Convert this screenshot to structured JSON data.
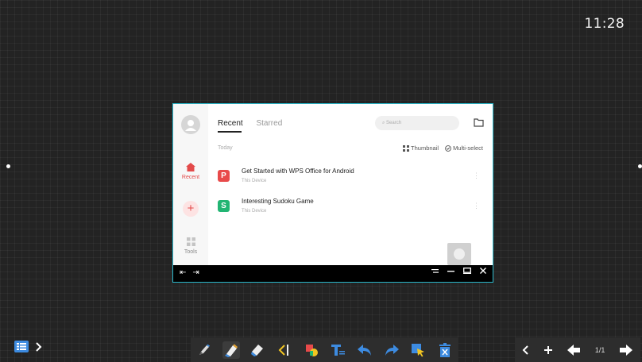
{
  "clock": "11:28",
  "window": {
    "tabs": [
      {
        "label": "Recent",
        "active": true
      },
      {
        "label": "Starred",
        "active": false
      }
    ],
    "search_placeholder": "Search",
    "sidebar": {
      "recent_label": "Recent",
      "tools_label": "Tools"
    },
    "section_title": "Today",
    "view_options": {
      "thumbnail": "Thumbnail",
      "multiselect": "Multi-select"
    },
    "files": [
      {
        "name": "Get Started with WPS Office for Android",
        "location": "This Device",
        "icon_letter": "P",
        "icon_color": "#e84a4a"
      },
      {
        "name": "Interesting Sudoku Game",
        "location": "This Device",
        "icon_letter": "S",
        "icon_color": "#22b573"
      }
    ]
  },
  "toolbar": {
    "page_counter": "1/1"
  },
  "colors": {
    "accent_red": "#e34a4a",
    "window_border": "#29b6c9",
    "toolbar_blue": "#3d8be0"
  }
}
